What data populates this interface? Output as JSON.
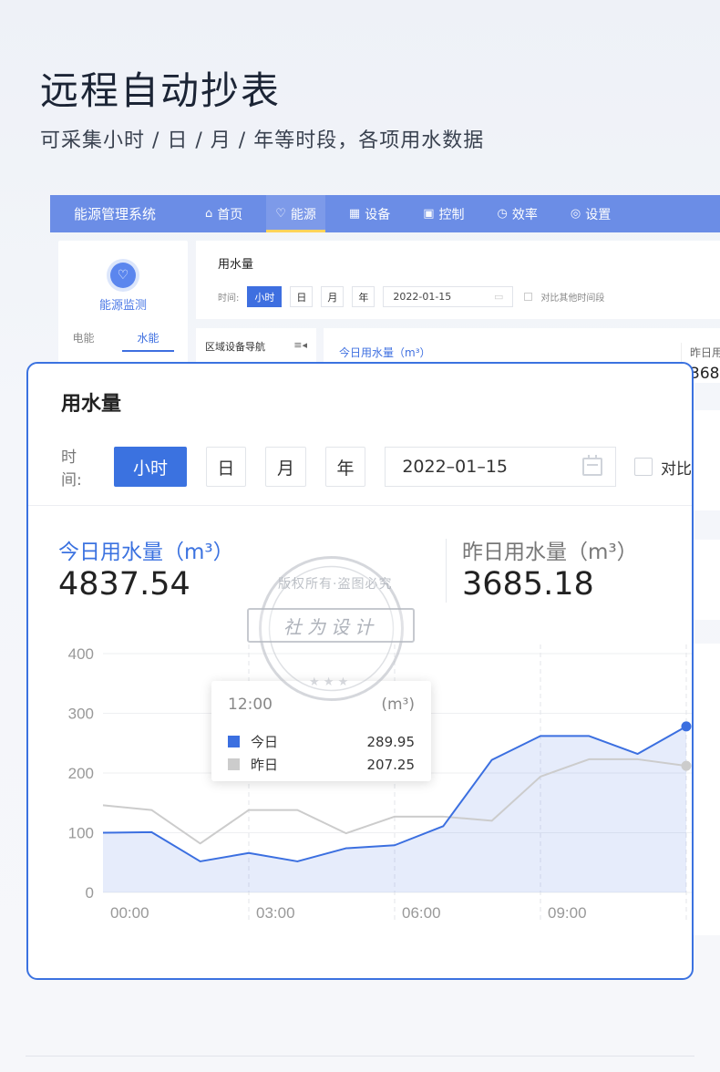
{
  "hero": {
    "title": "远程自动抄表",
    "subtitle": "可采集小时 / 日 / 月 / 年等时段，各项用水数据"
  },
  "background_app": {
    "brand": "能源管理系统",
    "nav": [
      {
        "label": "首页",
        "icon": "home-icon",
        "glyph": "⌂"
      },
      {
        "label": "能源",
        "icon": "bulb-icon",
        "glyph": "♡",
        "active": true
      },
      {
        "label": "设备",
        "icon": "grid-icon",
        "glyph": "▦"
      },
      {
        "label": "控制",
        "icon": "panel-icon",
        "glyph": "▣"
      },
      {
        "label": "效率",
        "icon": "clock-icon",
        "glyph": "◷"
      },
      {
        "label": "设置",
        "icon": "gear-icon",
        "glyph": "◎"
      }
    ],
    "side": {
      "title": "能源监测",
      "tabs": [
        "电能",
        "水能"
      ],
      "active_tab": "水能"
    },
    "top_card": {
      "title": "用水量",
      "time_label": "时间:",
      "buttons": [
        "小时",
        "日",
        "月",
        "年"
      ],
      "date": "2022-01-15",
      "compare_label": "对比其他时间段"
    },
    "area_nav_label": "区域设备导航",
    "area_nav_icon": "≡◂",
    "today_label": "今日用水量（m³）",
    "yesterday_label_partial": "昨日用",
    "yesterday_value_partial": "368"
  },
  "card": {
    "title": "用水量",
    "time_label": "时间:",
    "buttons": {
      "hour": "小时",
      "day": "日",
      "month": "月",
      "year": "年"
    },
    "active_button": "hour",
    "date": "2022–01–15",
    "compare_label": "对比",
    "today_label": "今日用水量（m³）",
    "today_value": "4837.54",
    "yesterday_label": "昨日用水量（m³）",
    "yesterday_value": "3685.18",
    "tooltip": {
      "time": "12:00",
      "unit": "(m³)",
      "rows": [
        {
          "name": "今日",
          "value": "289.95"
        },
        {
          "name": "昨日",
          "value": "207.25"
        }
      ]
    }
  },
  "watermark": {
    "band_text": "社为设计",
    "ring_text": "版权所有·盗图必究"
  },
  "colors": {
    "accent": "#3b72e0",
    "nav_bg": "#6b8de6",
    "today_series": "#3b6fe0",
    "yesterday_series": "#cccccc"
  },
  "chart_data": {
    "type": "area",
    "x": [
      "00:00",
      "01:00",
      "02:00",
      "03:00",
      "04:00",
      "05:00",
      "06:00",
      "07:00",
      "08:00",
      "09:00",
      "10:00",
      "11:00",
      "12:00"
    ],
    "x_ticks": [
      "00:00",
      "03:00",
      "06:00",
      "09:00"
    ],
    "ylim": [
      0,
      400
    ],
    "y_ticks": [
      0,
      100,
      200,
      300,
      400
    ],
    "grid": true,
    "series": [
      {
        "name": "今日",
        "color": "#3b6fe0",
        "filled": true,
        "values": [
          100,
          101,
          52,
          66,
          52,
          74,
          79,
          111,
          222,
          262,
          262,
          232,
          278
        ]
      },
      {
        "name": "昨日",
        "color": "#cccccc",
        "filled": false,
        "values": [
          146,
          138,
          82,
          138,
          138,
          99,
          127,
          127,
          120,
          194,
          223,
          223,
          212
        ]
      }
    ]
  }
}
